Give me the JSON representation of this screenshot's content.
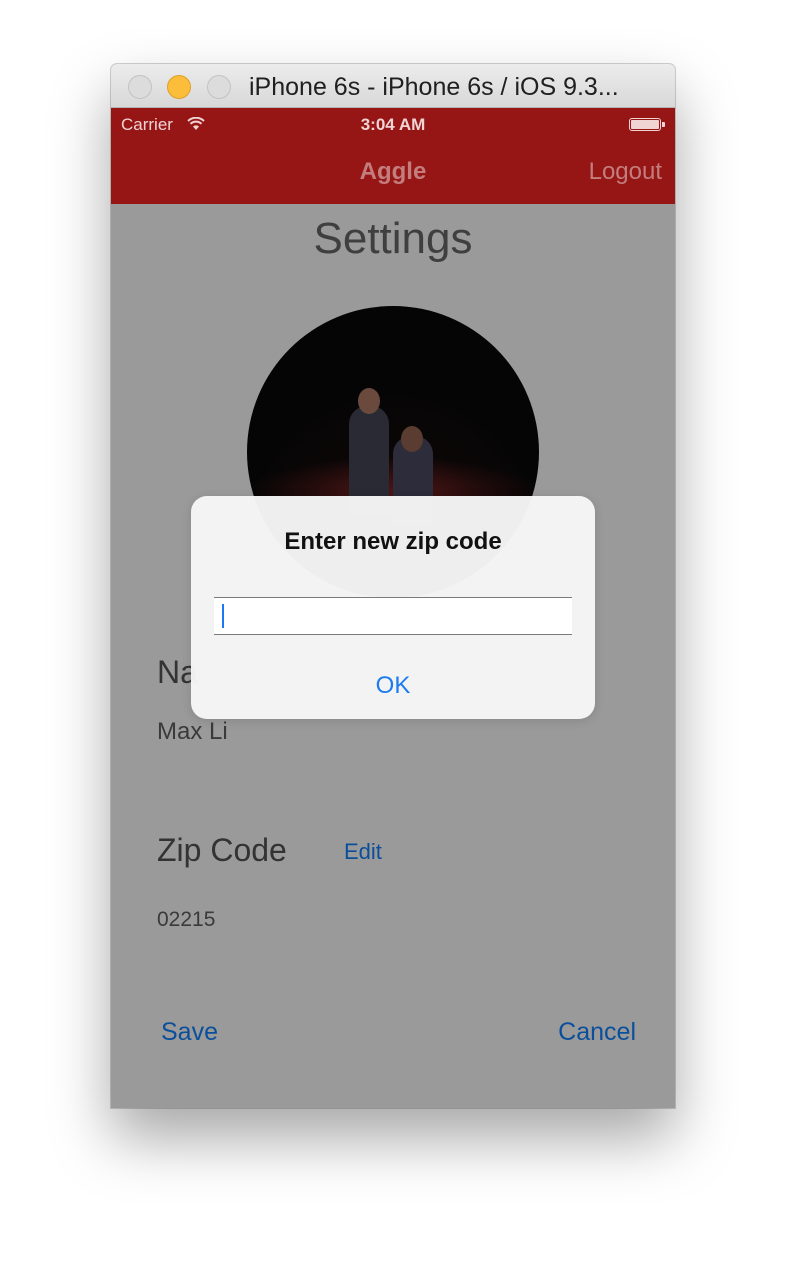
{
  "window": {
    "title": "iPhone 6s - iPhone 6s / iOS 9.3..."
  },
  "status_bar": {
    "carrier": "Carrier",
    "time": "3:04 AM"
  },
  "navbar": {
    "title": "Aggle",
    "logout_label": "Logout"
  },
  "page": {
    "title": "Settings",
    "name_label": "Na",
    "name_value": "Max Li",
    "zip_label": "Zip Code",
    "edit_label": "Edit",
    "zip_value": "02215",
    "save_label": "Save",
    "cancel_label": "Cancel"
  },
  "alert": {
    "title": "Enter new zip code",
    "input_value": "",
    "ok_label": "OK"
  },
  "colors": {
    "navbar": "#961616",
    "screen_dim": "#9a9a9a",
    "link": "#0b4f9a",
    "alert_button": "#1b7cf0"
  }
}
